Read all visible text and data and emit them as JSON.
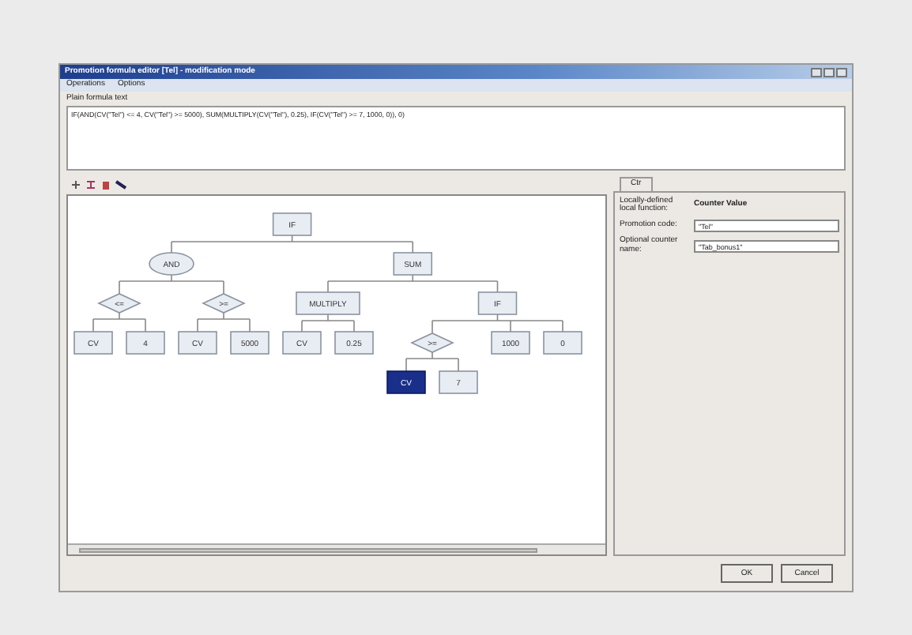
{
  "window": {
    "title": "Promotion formula editor [Tel] - modification mode"
  },
  "menu": [
    {
      "label": "Operations"
    },
    {
      "label": "Options"
    }
  ],
  "formula": {
    "label": "Plain formula text",
    "value": "IF(AND(CV(\"Tel\") <= 4, CV(\"Tel\") >= 5000), SUM(MULTIPLY(CV(\"Tel\"), 0.25), IF(CV(\"Tel\") >= 7, 1000, 0)), 0)"
  },
  "tree": {
    "label": "IF",
    "kind": "box",
    "selected": false,
    "children": [
      {
        "label": "AND",
        "kind": "ellipse",
        "selected": false,
        "children": [
          {
            "label": "<=",
            "kind": "diamond",
            "selected": false,
            "children": [
              {
                "label": "CV",
                "kind": "box",
                "selected": false
              },
              {
                "label": "4",
                "kind": "box",
                "selected": false
              }
            ]
          },
          {
            "label": ">=",
            "kind": "diamond",
            "selected": false,
            "children": [
              {
                "label": "CV",
                "kind": "box",
                "selected": false
              },
              {
                "label": "5000",
                "kind": "box",
                "selected": false
              }
            ]
          }
        ]
      },
      {
        "label": "SUM",
        "kind": "box",
        "selected": false,
        "children": [
          {
            "label": "MULTIPLY",
            "kind": "box",
            "selected": false,
            "children": [
              {
                "label": "CV",
                "kind": "box",
                "selected": false
              },
              {
                "label": "0.25",
                "kind": "box",
                "selected": false
              }
            ]
          },
          {
            "label": "IF",
            "kind": "box",
            "selected": false,
            "children": [
              {
                "label": ">=",
                "kind": "diamond",
                "selected": false,
                "children": [
                  {
                    "label": "CV",
                    "kind": "box",
                    "selected": true
                  },
                  {
                    "label": "7",
                    "kind": "box",
                    "selected": false
                  }
                ]
              },
              {
                "label": "1000",
                "kind": "box",
                "selected": false
              },
              {
                "label": "0",
                "kind": "box",
                "selected": false
              }
            ]
          }
        ]
      }
    ]
  },
  "side_tab": {
    "label": "Ctr",
    "selected": true
  },
  "properties": [
    {
      "label": "Locally-defined local function:",
      "value": "Counter Value",
      "kind": "text"
    },
    {
      "label": "Promotion code:",
      "value": "\"Tel\"",
      "kind": "input"
    },
    {
      "label": "Optional counter name:",
      "value": "\"Tab_bonus1\"",
      "kind": "input"
    }
  ],
  "buttons": [
    {
      "label": "OK"
    },
    {
      "label": "Cancel"
    }
  ]
}
